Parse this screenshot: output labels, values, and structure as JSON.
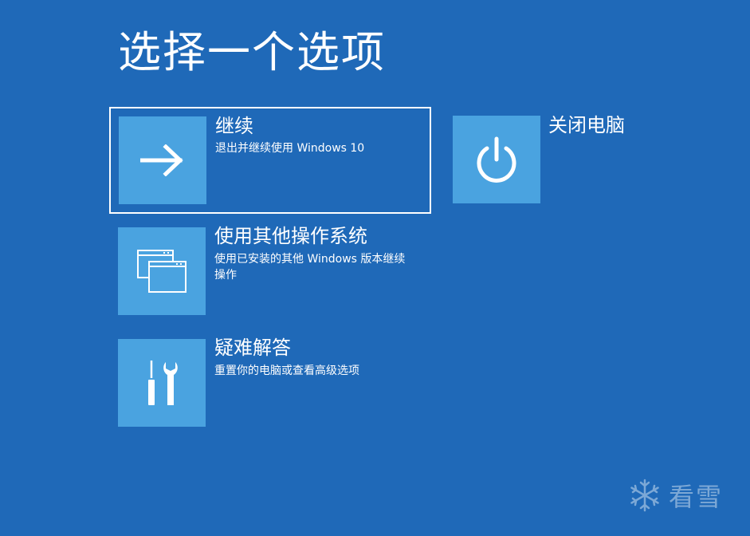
{
  "title": "选择一个选项",
  "options": {
    "continue": {
      "title": "继续",
      "description": "退出并继续使用 Windows 10",
      "icon": "arrow-right-icon"
    },
    "shutdown": {
      "title": "关闭电脑",
      "icon": "power-icon"
    },
    "other_os": {
      "title": "使用其他操作系统",
      "description": "使用已安装的其他 Windows 版本继续操作",
      "icon": "windows-stack-icon"
    },
    "troubleshoot": {
      "title": "疑难解答",
      "description": "重置你的电脑或查看高级选项",
      "icon": "tools-icon"
    }
  },
  "watermark": {
    "text": "看雪",
    "icon": "snowflake-icon"
  },
  "colors": {
    "background": "#1f69b8",
    "tile": "#4aa3e0",
    "text": "#ffffff"
  }
}
